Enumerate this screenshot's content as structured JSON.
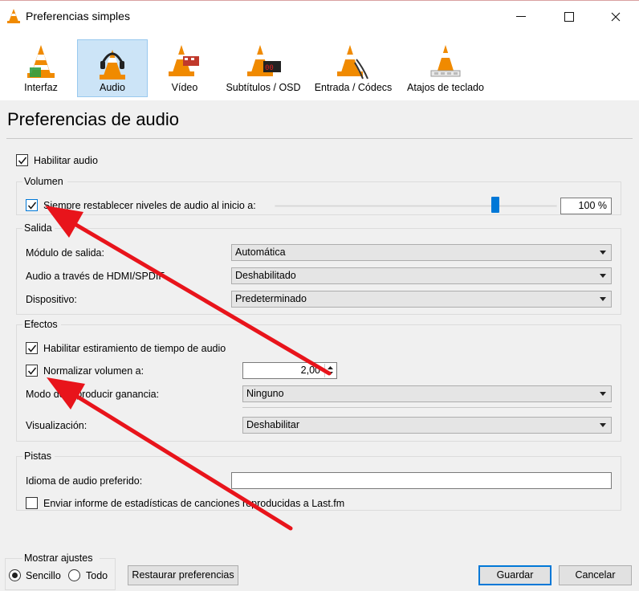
{
  "window": {
    "title": "Preferencias simples"
  },
  "toolbar": {
    "items": [
      {
        "label": "Interfaz",
        "icon": "interface-cone-icon",
        "selected": false
      },
      {
        "label": "Audio",
        "icon": "headphones-cone-icon",
        "selected": true
      },
      {
        "label": "Vídeo",
        "icon": "video-cone-icon",
        "selected": false
      },
      {
        "label": "Subtítulos / OSD",
        "icon": "subtitles-cone-icon",
        "selected": false
      },
      {
        "label": "Entrada / Códecs",
        "icon": "input-cone-icon",
        "selected": false
      },
      {
        "label": "Atajos de teclado",
        "icon": "hotkeys-cone-icon",
        "selected": false
      }
    ]
  },
  "page_title": "Preferencias de audio",
  "enable_audio": {
    "label": "Habilitar audio",
    "checked": true
  },
  "volume": {
    "group_label": "Volumen",
    "reset_label": "Siempre restablecer niveles de audio al inicio a:",
    "reset_checked": true,
    "value_text": "100 %",
    "slider_fraction": 0.78
  },
  "output": {
    "group_label": "Salida",
    "module_label": "Módulo de salida:",
    "module_value": "Automática",
    "hdmi_label": "Audio a través de HDMI/SPDIF",
    "hdmi_value": "Deshabilitado",
    "device_label": "Dispositivo:",
    "device_value": "Predeterminado"
  },
  "effects": {
    "group_label": "Efectos",
    "stretch_label": "Habilitar estiramiento de tiempo de audio",
    "stretch_checked": true,
    "normalize_label": "Normalizar volumen a:",
    "normalize_checked": true,
    "normalize_value": "2,00",
    "replay_label": "Modo de reproducir ganancia:",
    "replay_value": "Ninguno",
    "visual_label": "Visualización:",
    "visual_value": "Deshabilitar"
  },
  "tracks": {
    "group_label": "Pistas",
    "lang_label": "Idioma de audio preferido:",
    "lang_value": "",
    "lastfm_label": "Enviar informe de estadísticas de canciones reproducidas a Last.fm",
    "lastfm_checked": false
  },
  "show_settings": {
    "group_label": "Mostrar ajustes",
    "simple_label": "Sencillo",
    "all_label": "Todo",
    "selected": "simple"
  },
  "buttons": {
    "reset": "Restaurar preferencias",
    "save": "Guardar",
    "cancel": "Cancelar"
  },
  "colors": {
    "accent": "#0078d7",
    "selected_tab_bg": "#cce4f7",
    "annotation_arrow": "#e8141b",
    "vlc_orange": "#f08a00"
  }
}
